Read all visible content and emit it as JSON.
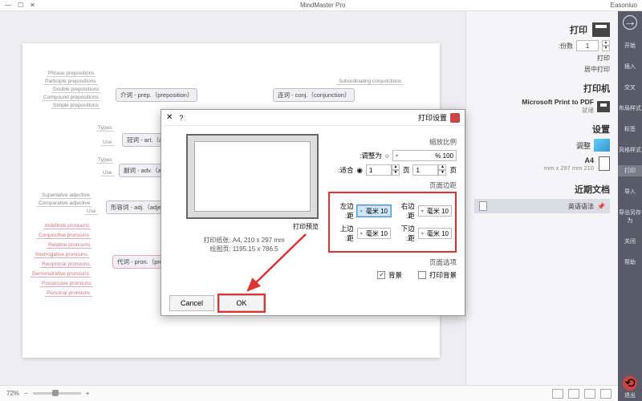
{
  "titlebar": {
    "title": "MindMaster Pro",
    "user": "Easonluo"
  },
  "vtoolbar": {
    "items": [
      {
        "label": "开始"
      },
      {
        "label": "插入"
      },
      {
        "label": "交叉"
      },
      {
        "label": "布局样式"
      },
      {
        "label": "标签"
      },
      {
        "label": "风格样式"
      },
      {
        "label": "打印"
      },
      {
        "label": "导入"
      },
      {
        "label": "导出另存为"
      },
      {
        "label": "关闭"
      },
      {
        "label": "帮助"
      },
      {
        "label": "退出"
      }
    ]
  },
  "sidepanel": {
    "print_title": "打印",
    "copies_label": "份数:",
    "copies_value": "1",
    "center_label": "居中打印",
    "printer_title": "打印机",
    "printer_name": "Microsoft Print to PDF",
    "ready_label": "就绪",
    "settings_title": "设置",
    "adjust_label": "调整",
    "paper_name": "A4",
    "paper_dims": "210 mm x 297 mm",
    "recent_title": "近期文档",
    "recent_item": "英语语法"
  },
  "mindmap": {
    "t_prep": "介词 - prep.（preposition）",
    "t_conj": "连词 - conj.（conjunction）",
    "t_art": "冠词 - art.（article）",
    "t_adv": "副词 - adv.（adverb）",
    "t_adj": "形容词 - adj.（adjective）",
    "t_pron": "代词 - pron.（pronoun）",
    "l_sub": "Subordinating conjunctions",
    "l_phr": "Phrase prepositions",
    "l_part": "Participle prepositions",
    "l_dbl": "Double prepositions",
    "l_cmp": "Compound prepositions",
    "l_simp": "Simple prepositions",
    "l_types": "Types",
    "l_use": "Use",
    "l_sup": "Superlative adjective",
    "l_cmpadj": "Comparative adjective",
    "l_ind": "Indefinite pronouns",
    "l_conj": "Conjunctive pronouns",
    "l_rel": "Relative pronouns",
    "l_int": "Interrogative pronouns",
    "l_rec": "Reciprocal pronouns",
    "l_dem": "Demonstrative pronouns",
    "l_pos": "Possessive pronouns",
    "l_per": "Personal pronouns"
  },
  "dialog": {
    "title": "打印设置",
    "scale_group": "缩放比例",
    "scale_mode": "调整为:",
    "scale_pct": "100 %",
    "fit_mode": "适合:",
    "fit_w": "1",
    "fit_w_unit": "页",
    "fit_h": "1",
    "fit_h_unit": "页",
    "margins_title": "页面边距",
    "left_lbl": "左边距:",
    "left_val": "10 毫米",
    "right_lbl": "右边距:",
    "right_val": "10 毫米",
    "top_lbl": "上边距:",
    "top_val": "10 毫米",
    "bottom_lbl": "下边距:",
    "bottom_val": "10 毫米",
    "options_title": "页面选项",
    "bg_chk": "背景",
    "bg_chk2": "打印背景",
    "preview_lbl": "打印预览",
    "size_line1": "打印纸张: A4, 210 x 297 mm",
    "size_line2": "绘图页: 1195.15 x 786.5",
    "ok": "OK",
    "cancel": "Cancel",
    "help": "?"
  },
  "statusbar": {
    "zoom": "72%"
  }
}
